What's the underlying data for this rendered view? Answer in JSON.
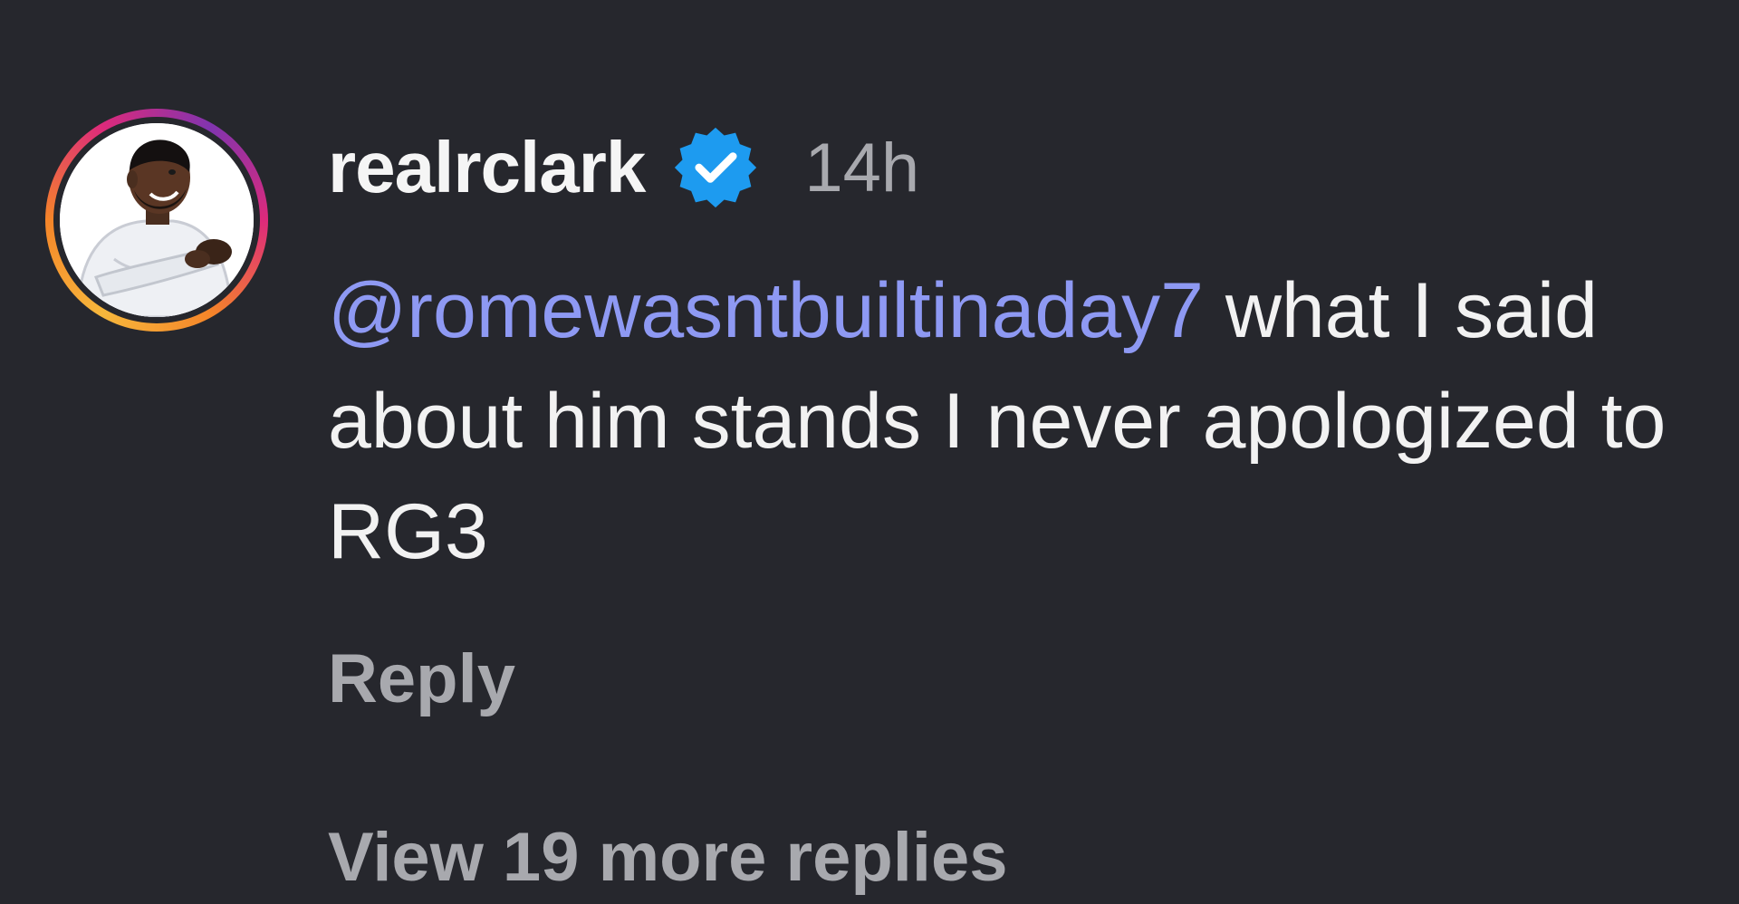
{
  "comment": {
    "avatar_icon": "profile-picture",
    "username": "realrclark",
    "verified_icon": "verified-badge-icon",
    "timestamp": "14h",
    "mention": "@romewasntbuiltinaday7",
    "text": " what I said about him stands I never apologized to RG3",
    "reply_label": "Reply",
    "view_more_label": "View 19 more replies"
  },
  "colors": {
    "background": "#26272d",
    "mention": "#8e99f3",
    "verified": "#1d9bf0",
    "muted_text": "#a8a9ae"
  }
}
